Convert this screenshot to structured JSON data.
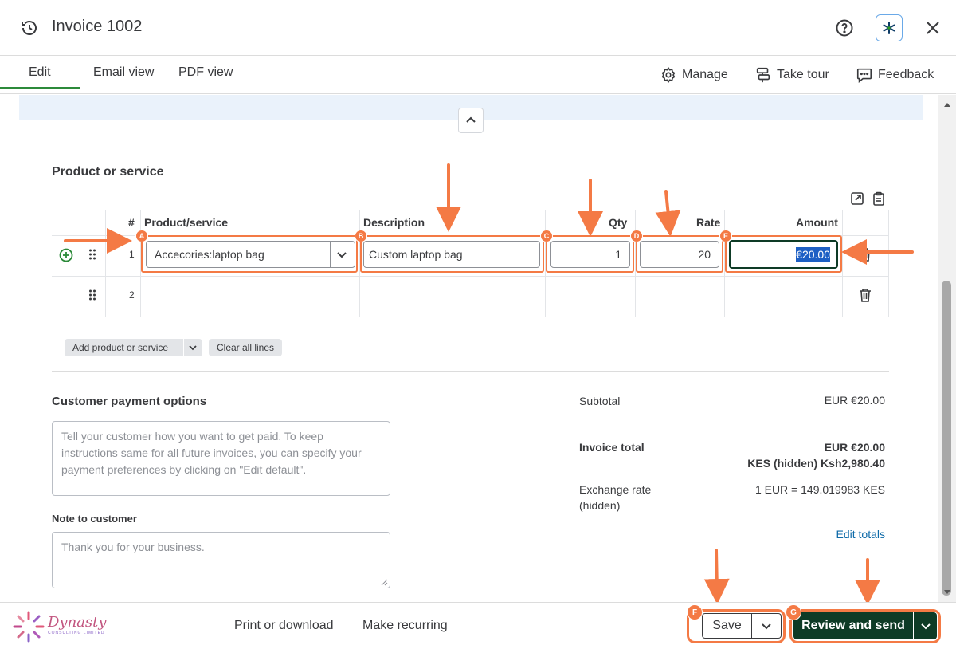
{
  "header": {
    "title": "Invoice 1002"
  },
  "tabs": [
    {
      "label": "Edit"
    },
    {
      "label": "Email view"
    },
    {
      "label": "PDF view"
    }
  ],
  "toolbar": {
    "manage": "Manage",
    "take_tour": "Take tour",
    "feedback": "Feedback"
  },
  "product_section": {
    "title": "Product or service",
    "columns": {
      "num": "#",
      "product": "Product/service",
      "description": "Description",
      "qty": "Qty",
      "rate": "Rate",
      "amount": "Amount"
    },
    "rows": [
      {
        "num": "1",
        "product": "Accecories:laptop bag",
        "description": "Custom laptop bag",
        "qty": "1",
        "rate": "20",
        "amount": "€20.00"
      },
      {
        "num": "2",
        "product": "",
        "description": "",
        "qty": "",
        "rate": "",
        "amount": ""
      }
    ],
    "add_button": "Add product or service",
    "clear_button": "Clear all lines"
  },
  "annotations": {
    "a": "A",
    "b": "B",
    "c": "C",
    "d": "D",
    "e": "E",
    "f": "F",
    "g": "G",
    "color": "#f47a45"
  },
  "payment": {
    "title": "Customer payment options",
    "placeholder": "Tell your customer how you want to get paid. To keep instructions same for all future invoices, you can specify your payment preferences by clicking on \"Edit default\".",
    "note_label": "Note to customer",
    "note_value": "Thank you for your business."
  },
  "totals": {
    "subtotal_label": "Subtotal",
    "subtotal_value": "EUR €20.00",
    "invoice_total_label": "Invoice total",
    "invoice_total_value": "EUR €20.00",
    "invoice_total_home": "KES (hidden) Ksh2,980.40",
    "exchange_label_1": "Exchange rate",
    "exchange_label_2": "(hidden)",
    "exchange_value": "1 EUR = 149.019983 KES",
    "edit_totals": "Edit totals"
  },
  "footer": {
    "logo_text": "Dynasty",
    "logo_sub": "CONSULTING LIMITED",
    "print": "Print or download",
    "recurring": "Make recurring",
    "save": "Save",
    "review_send": "Review and send"
  },
  "colors": {
    "brand_green": "#2c8a3a",
    "dark_green": "#0e3b26",
    "link_blue": "#0d6aa8",
    "highlight": "#1d5fc4"
  }
}
